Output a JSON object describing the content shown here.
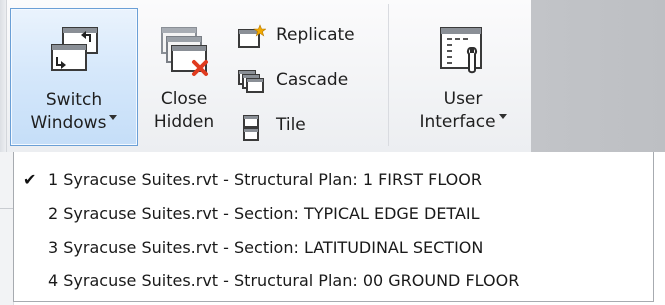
{
  "ribbon": {
    "switch_windows": {
      "line1": "Switch",
      "line2": "Windows",
      "icon": "switch-windows-icon"
    },
    "close_hidden": {
      "line1": "Close",
      "line2": "Hidden",
      "icon": "close-hidden-icon"
    },
    "replicate": {
      "label": "Replicate",
      "icon": "replicate-icon"
    },
    "cascade": {
      "label": "Cascade",
      "icon": "cascade-icon"
    },
    "tile": {
      "label": "Tile",
      "icon": "tile-icon"
    },
    "user_interface": {
      "line1": "User",
      "line2": "Interface",
      "icon": "user-interface-icon"
    }
  },
  "menu": {
    "items": [
      {
        "label": "1 Syracuse Suites.rvt - Structural Plan: 1 FIRST FLOOR",
        "checked": true,
        "check_mark": "✔"
      },
      {
        "label": "2 Syracuse Suites.rvt - Section: TYPICAL EDGE DETAIL",
        "checked": false
      },
      {
        "label": "3 Syracuse Suites.rvt - Section: LATITUDINAL SECTION",
        "checked": false
      },
      {
        "label": "4 Syracuse Suites.rvt - Structural Plan: 00 GROUND FLOOR",
        "checked": false
      }
    ]
  },
  "colors": {
    "active_button_border": "#6a9fd6",
    "active_button_fill": "#d6e8fb",
    "close_x": "#e03b1f",
    "replicate_star": "#f2a900"
  }
}
